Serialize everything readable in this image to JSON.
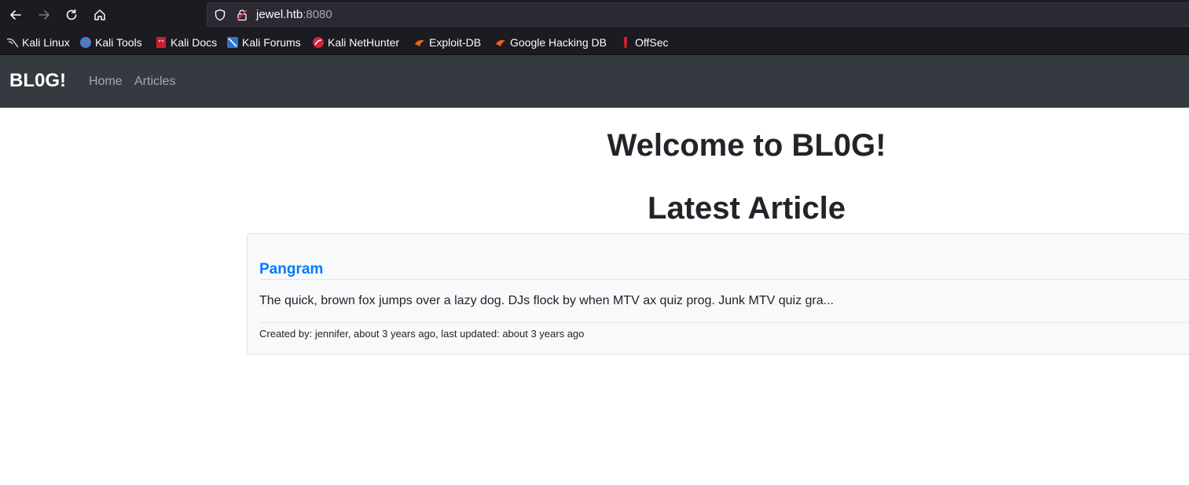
{
  "browser": {
    "url_host": "jewel.htb",
    "url_port": ":8080",
    "bookmarks": [
      {
        "label": "Kali Linux",
        "icon": "kali-dragon-icon"
      },
      {
        "label": "Kali Tools",
        "icon": "kali-tools-icon"
      },
      {
        "label": "Kali Docs",
        "icon": "kali-docs-icon"
      },
      {
        "label": "Kali Forums",
        "icon": "kali-forums-icon"
      },
      {
        "label": "Kali NetHunter",
        "icon": "kali-nethunter-icon"
      },
      {
        "label": "Exploit-DB",
        "icon": "exploit-db-icon"
      },
      {
        "label": "Google Hacking DB",
        "icon": "ghdb-icon"
      },
      {
        "label": "OffSec",
        "icon": "offsec-icon"
      }
    ]
  },
  "site": {
    "brand": "BL0G!",
    "nav": [
      {
        "label": "Home"
      },
      {
        "label": "Articles"
      }
    ]
  },
  "main": {
    "welcome_heading": "Welcome to BL0G!",
    "latest_heading": "Latest Article",
    "article": {
      "title": "Pangram",
      "excerpt": "The quick, brown fox jumps over a lazy dog. DJs flock by when MTV ax quiz prog. Junk MTV quiz gra...",
      "meta": "Created by: jennifer, about 3 years ago, last updated: about 3 years ago"
    }
  },
  "colors": {
    "navbar_bg": "#343a40",
    "link_blue": "#007bff",
    "chrome_bg": "#1c1b22"
  }
}
